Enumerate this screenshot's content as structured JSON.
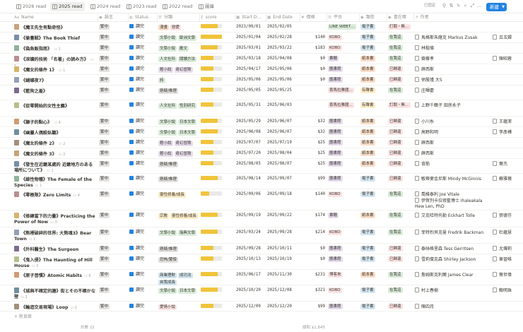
{
  "tabs": [
    {
      "label": "2026 read",
      "active": false
    },
    {
      "label": "2025 read",
      "active": true
    },
    {
      "label": "2024 read",
      "active": false
    },
    {
      "label": "2023 read",
      "active": false
    },
    {
      "label": "2022 read",
      "active": false
    },
    {
      "label": "圖庫",
      "active": false
    }
  ],
  "toolbar": {
    "saved_label": "已固定",
    "new_label": "新建"
  },
  "columns": {
    "name": "Name",
    "lang": "語言",
    "status": "Status",
    "category": "分類",
    "score": "score",
    "start": "Start D…",
    "end": "End Date",
    "price": "價格",
    "platform": "平台",
    "type": "類型",
    "location": "書在哪",
    "author": "作者"
  },
  "rows": [
    {
      "title": "《魔王先生有點奇怪》",
      "comments": "",
      "lang": "繁中",
      "status": "讀完",
      "tags": [
        [
          "漫畫",
          "#fadec9"
        ],
        [
          "戀愛",
          "#fbe4e4"
        ]
      ],
      "score": 4,
      "start": "2023/09/01",
      "end": "2025/02/05",
      "price": "",
      "platform": [
        [
          "LINE WEBT…",
          "#dbeddb"
        ]
      ],
      "type": [
        "電子書",
        "#d3e5ef"
      ],
      "location": [
        "訂閱・無…",
        "#fbe4e4"
      ],
      "authors": [],
      "author2": ""
    },
    {
      "title": "《偷書賊》The Book Thief",
      "comments": "",
      "lang": "繁中",
      "status": "讀完",
      "tags": [
        [
          "文學小說",
          "#dbeddb"
        ],
        [
          "歐洲文學",
          "#dbeddb"
        ]
      ],
      "score": 5,
      "start": "2025/01/04",
      "end": "2025/02/28",
      "price": "$140",
      "platform": [
        [
          "KOBO",
          "#fbe4e4"
        ]
      ],
      "type": [
        "電子書",
        "#d3e5ef"
      ],
      "location": [
        "在我這",
        "#dbeddb"
      ],
      "authors": [
        "馬格斯朱薩克 Markus Zusak"
      ],
      "author2": "呂玉嬋"
    },
    {
      "title": "《偽魚販指南》",
      "comments": "1",
      "lang": "繁中",
      "status": "讀完",
      "tags": [
        [
          "文學小說",
          "#dbeddb"
        ],
        [
          "散文",
          "#dbeddb"
        ]
      ],
      "score": 4,
      "start": "2025/03/01",
      "end": "2025/03/22",
      "price": "$183",
      "platform": [
        [
          "KOBO",
          "#fbe4e4"
        ]
      ],
      "type": [
        "電子書",
        "#d3e5ef"
      ],
      "location": [
        "在我這",
        "#dbeddb"
      ],
      "authors": [
        "林楷倫"
      ],
      "author2": ""
    },
    {
      "title": "《深讀的技術 「名著」の読み方》",
      "comments": "1",
      "lang": "繁中",
      "status": "讀完",
      "tags": [
        [
          "人文社科",
          "#dbeddb"
        ],
        [
          "閱讀方法",
          "#dbeddb"
        ]
      ],
      "score": 3,
      "start": "2025/03/18",
      "end": "2025/04/08",
      "price": "$0",
      "platform": [
        [
          "書櫃",
          "#e8deee"
        ]
      ],
      "type": [
        "紙本書",
        "#fadec9"
      ],
      "location": [
        "在我這",
        "#dbeddb"
      ],
      "authors": [
        "齋藤孝"
      ],
      "author2": "陳昭蓉"
    },
    {
      "title": "《魔女的條件 1》",
      "comments": "1",
      "lang": "繁中",
      "status": "讀完",
      "tags": [
        [
          "輕小說",
          "#e8deee"
        ],
        [
          "奇幻冒險",
          "#e8deee"
        ]
      ],
      "score": 3,
      "start": "2025/04/17",
      "end": "2025/05/06",
      "price": "$0",
      "platform": [
        [
          "圖書館",
          "#e8deee"
        ]
      ],
      "type": [
        "紙本書",
        "#fadec9"
      ],
      "location": [
        "已歸還",
        "#fbe4e4"
      ],
      "authors": [
        "薛西斯"
      ],
      "author2": ""
    },
    {
      "title": "《蝴蝶夜7》",
      "comments": "",
      "lang": "繁中",
      "status": "讀完",
      "tags": [
        [
          "詩",
          "#dbeddb"
        ]
      ],
      "score": 3,
      "start": "2025/05/06",
      "end": "2025/05/06",
      "price": "$0",
      "platform": [
        [
          "圖書館",
          "#e8deee"
        ]
      ],
      "type": [
        "紙本書",
        "#fadec9"
      ],
      "location": [
        "已歸還",
        "#fbe4e4"
      ],
      "authors": [
        "徐殷瑾 大S"
      ],
      "author2": ""
    },
    {
      "title": "《籃狗之羞》",
      "comments": "",
      "lang": "繁中",
      "status": "讀完",
      "tags": [
        [
          "懸疑/推理",
          "#e3e2e0"
        ]
      ],
      "score": 3,
      "start": "2025/05/05",
      "end": "2025/05/25",
      "price": "",
      "platform": [
        [
          "喜馬拉雅國…",
          "#fbe4e4"
        ]
      ],
      "type": [
        "有聲書",
        "#fdecc8"
      ],
      "location": [
        "在我這",
        "#dbeddb"
      ],
      "authors": [
        "庄暉慶"
      ],
      "author2": ""
    },
    {
      "title": "《從零開始的女性主義》",
      "comments": "",
      "lang": "繁中",
      "status": "讀完",
      "tags": [
        [
          "人文社科",
          "#dbeddb"
        ],
        [
          "性別研究",
          "#dbeddb"
        ]
      ],
      "score": 3,
      "start": "2025/05/31",
      "end": "2025/06/03",
      "price": "",
      "platform": [
        [
          "喜馬拉雅國…",
          "#fbe4e4"
        ]
      ],
      "type": [
        "有聲書",
        "#fdecc8"
      ],
      "location": [
        "訂閱・無…",
        "#fbe4e4"
      ],
      "authors": [
        "上野千鶴子 田房永子"
      ],
      "author2": ""
    },
    {
      "title": "《獅子的點心》",
      "comments": "4",
      "lang": "繁中",
      "status": "讀完",
      "tags": [
        [
          "文學小說",
          "#dbeddb"
        ],
        [
          "日本文學",
          "#dbeddb"
        ]
      ],
      "score": 4,
      "start": "2025/05/29",
      "end": "2025/06/07",
      "price": "$32",
      "platform": [
        [
          "圖書館",
          "#e8deee"
        ]
      ],
      "type": [
        "紙本書",
        "#fadec9"
      ],
      "location": [
        "已歸還",
        "#fbe4e4"
      ],
      "authors": [
        "小川糸"
      ],
      "author2": "王蘊潔"
    },
    {
      "title": "《幽靈人偶殺臥聽》",
      "comments": "",
      "lang": "繁中",
      "status": "讀完",
      "tags": [
        [
          "文學小說",
          "#dbeddb"
        ],
        [
          "日本文學",
          "#dbeddb"
        ]
      ],
      "score": 4,
      "start": "2025/06/08",
      "end": "2025/06/07",
      "price": "$32",
      "platform": [
        [
          "圖書館",
          "#e8deee"
        ]
      ],
      "type": [
        "紙本書",
        "#fadec9"
      ],
      "location": [
        "已歸還",
        "#fbe4e4"
      ],
      "authors": [
        "高野和明"
      ],
      "author2": "李彥樺"
    },
    {
      "title": "《魔女的條件 2》",
      "comments": "2",
      "lang": "繁中",
      "status": "讀完",
      "tags": [
        [
          "輕小說",
          "#e8deee"
        ],
        [
          "奇幻冒險",
          "#e8deee"
        ]
      ],
      "score": 3,
      "start": "2025/07/07",
      "end": "2025/07/19",
      "price": "$25",
      "platform": [
        [
          "圖書館",
          "#e8deee"
        ]
      ],
      "type": [
        "紙本書",
        "#fadec9"
      ],
      "location": [
        "已歸還",
        "#fbe4e4"
      ],
      "authors": [
        "薛西斯"
      ],
      "author2": ""
    },
    {
      "title": "《魔女的條件 3》",
      "comments": "2",
      "lang": "繁中",
      "status": "讀完",
      "tags": [
        [
          "輕小說",
          "#e8deee"
        ],
        [
          "奇幻冒險",
          "#e8deee"
        ]
      ],
      "score": 3,
      "start": "2025/07/20",
      "end": "2025/08/04",
      "price": "$25",
      "platform": [
        [
          "圖書館",
          "#e8deee"
        ]
      ],
      "type": [
        "紙本書",
        "#fadec9"
      ],
      "location": [
        "已歸還",
        "#fbe4e4"
      ],
      "authors": [
        "薛西斯"
      ],
      "author2": ""
    },
    {
      "title": "《發生在近畿某處的 近畿地方のある場所について》",
      "comments": "1",
      "lang": "繁中",
      "status": "讀完",
      "tags": [
        [
          "懸疑/推理",
          "#e3e2e0"
        ]
      ],
      "score": 3,
      "start": "2025/08/05",
      "end": "2025/08/07",
      "price": "$25",
      "platform": [
        [
          "圖書館",
          "#e8deee"
        ]
      ],
      "type": [
        "紙本書",
        "#fadec9"
      ],
      "location": [
        "已歸還",
        "#fbe4e4"
      ],
      "authors": [
        "背筋"
      ],
      "author2": "葉杰"
    },
    {
      "title": "《雌性物種》The Female of the Species",
      "comments": "1",
      "lang": "繁中",
      "status": "讀完",
      "tags": [
        [
          "懸疑/推理",
          "#e3e2e0"
        ]
      ],
      "score": 4,
      "start": "2025/08/14",
      "end": "2025/09/07",
      "price": "$99",
      "platform": [
        [
          "圖書館",
          "#e8deee"
        ]
      ],
      "type": [
        "電子書",
        "#d3e5ef"
      ],
      "location": [
        "已歸還",
        "#fbe4e4"
      ],
      "authors": [
        "敏蒂麥金尼斯 Mindy McGinnis"
      ],
      "author2": "蘇雅薇"
    },
    {
      "title": "《零極限》Zero Limits",
      "comments": "4",
      "lang": "繁中",
      "status": "讀完",
      "tags": [
        [
          "靈性修養/成長",
          "#fdecc8"
        ]
      ],
      "score": 2,
      "start": "2025/09/06",
      "end": "2025/09/18",
      "price": "$140",
      "platform": [
        [
          "KOBO",
          "#fbe4e4"
        ]
      ],
      "type": [
        "電子書",
        "#d3e5ef"
      ],
      "location": [
        "在我這",
        "#dbeddb"
      ],
      "authors": [
        "喬維泰利 Joe Vitale",
        "伊賀列卡拉修藍博士 Ihaleakala Hew Len, PhD"
      ],
      "author2": ""
    },
    {
      "title": "《修練當下的力量》Practicing the Power of Now",
      "comments": "3",
      "lang": "繁中",
      "status": "讀完",
      "tags": [
        [
          "宗教",
          "#fdecc8"
        ],
        [
          "靈性修養/成長",
          "#fdecc8"
        ]
      ],
      "score": 4,
      "start": "2025/09/19",
      "end": "2025/09/22",
      "price": "$174",
      "platform": [
        [
          "書櫃",
          "#e8deee"
        ]
      ],
      "type": [
        "紙本書",
        "#fadec9"
      ],
      "location": [
        "在我這",
        "#dbeddb"
      ],
      "authors": [
        "艾克哈特托勒 Eckhart Tolle"
      ],
      "author2": "張德芬"
    },
    {
      "title": "《熊裡破碎的世界: 大熊魂3》Bear Town",
      "comments": "1",
      "lang": "繁中",
      "status": "讀完",
      "tags": [
        [
          "文學小說",
          "#dbeddb"
        ],
        [
          "瑞典文學",
          "#dbeddb"
        ]
      ],
      "score": 4,
      "start": "2025/03/24",
      "end": "2025/09/28",
      "price": "$214",
      "platform": [
        [
          "KOBO",
          "#fbe4e4"
        ]
      ],
      "type": [
        "電子書",
        "#d3e5ef"
      ],
      "location": [
        "在我這",
        "#dbeddb"
      ],
      "authors": [
        "菲特烈貝克曼 Fredrik Backman"
      ],
      "author2": "杜蘊慧"
    },
    {
      "title": "《外科醫生》The Surgeon",
      "comments": "",
      "lang": "繁中",
      "status": "讀完",
      "tags": [
        [
          "懸疑/推理",
          "#e3e2e0"
        ]
      ],
      "score": 3,
      "start": "2025/09/28",
      "end": "2025/10/11",
      "price": "$0",
      "platform": [
        [
          "圖書館",
          "#e8deee"
        ]
      ],
      "type": [
        "電子書",
        "#d3e5ef"
      ],
      "location": [
        "已歸還",
        "#fbe4e4"
      ],
      "authors": [
        "泰絲格里森 Tess Gerritsen"
      ],
      "author2": "尤傳莉"
    },
    {
      "title": "《鬼入侵》The Haunting of Hill House",
      "comments": "3",
      "lang": "繁中",
      "status": "讀完",
      "tags": [
        [
          "恐怖/驚悚",
          "#e3e2e0"
        ]
      ],
      "score": 3,
      "start": "2025/10/13",
      "end": "2025/10/19",
      "price": "$0",
      "platform": [
        [
          "圖書館",
          "#e8deee"
        ]
      ],
      "type": [
        "電子書",
        "#d3e5ef"
      ],
      "location": [
        "已歸還",
        "#fbe4e4"
      ],
      "authors": [
        "雪莉傑克森 Shirley Jackson"
      ],
      "author2": "章晉唯"
    },
    {
      "title": "《原子習慣》Atomic Habits",
      "comments": "6",
      "lang": "繁中",
      "status": "讀完",
      "tags": [
        [
          "商業理財",
          "#d3e5ef"
        ],
        [
          "成功法",
          "#d3e5ef"
        ],
        [
          "自我成長",
          "#d3e5ef"
        ]
      ],
      "score": 4,
      "start": "2025/06/17",
      "end": "2025/11/30",
      "price": "$231",
      "platform": [
        [
          "博客來",
          "#fbe4e4"
        ]
      ],
      "type": [
        "紙本書",
        "#fadec9"
      ],
      "location": [
        "在我這",
        "#dbeddb"
      ],
      "authors": [
        "詹姆斯克利爾 James Clear"
      ],
      "author2": "蔡世偉"
    },
    {
      "title": "《城與不確定的牆》街とその不確かな壁",
      "comments": "1",
      "lang": "繁中",
      "status": "讀完",
      "tags": [
        [
          "文學小說",
          "#dbeddb"
        ],
        [
          "日本文學",
          "#dbeddb"
        ]
      ],
      "score": 4,
      "start": "2025/10/20",
      "end": "2025/12/08",
      "price": "$321",
      "platform": [
        [
          "KOBO",
          "#fbe4e4"
        ]
      ],
      "type": [
        "電子書",
        "#d3e5ef"
      ],
      "location": [
        "在我這",
        "#dbeddb"
      ],
      "authors": [
        "村上春樹"
      ],
      "author2": "賴明珠"
    },
    {
      "title": "《輪迴交易現場》Loop",
      "comments": "2",
      "lang": "繁中",
      "status": "讀完",
      "tags": [
        [
          "愛情小說",
          "#fbe4e4"
        ]
      ],
      "score": 3,
      "start": "2025/12/09",
      "end": "2025/12/20",
      "price": "$99",
      "platform": [
        [
          "圖書館",
          "#e8deee"
        ]
      ],
      "type": [
        "電子書",
        "#d3e5ef"
      ],
      "location": [
        "已歸還",
        "#fbe4e4"
      ],
      "authors": [
        "陳四月"
      ],
      "author2": ""
    }
  ],
  "footer": {
    "add_label": "+ 新頁面",
    "count_label": "計數 22",
    "sum_label": "總和 $1,845"
  }
}
